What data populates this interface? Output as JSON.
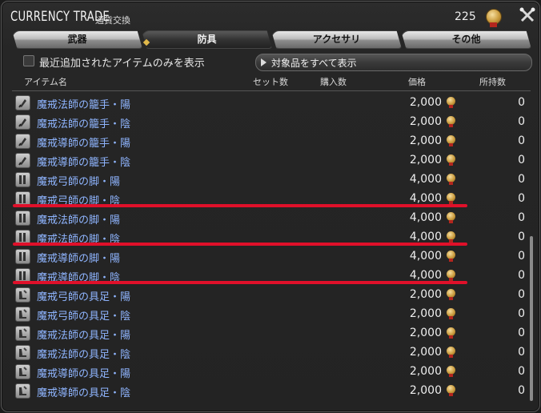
{
  "window": {
    "title": "CURRENCY TRADE",
    "subtitle": "通貨交換",
    "currency_count": "225"
  },
  "tabs": [
    {
      "label": "武器",
      "active": false
    },
    {
      "label": "防具",
      "active": true
    },
    {
      "label": "アクセサリ",
      "active": false
    },
    {
      "label": "その他",
      "active": false
    }
  ],
  "filter": {
    "checkbox_label": "最近追加されたアイテムのみを表示",
    "checked": false,
    "show_all_label": "対象品をすべて表示"
  },
  "columns": {
    "item_name": "アイテム名",
    "set_count": "セット数",
    "purchase_count": "購入数",
    "price": "価格",
    "owned": "所持数"
  },
  "rows": [
    {
      "icon": "gauntlet-icon",
      "name": "魔戒法師の籠手・陽",
      "price": "2,000",
      "owned": "0"
    },
    {
      "icon": "gauntlet-icon",
      "name": "魔戒法師の籠手・陰",
      "price": "2,000",
      "owned": "0"
    },
    {
      "icon": "gauntlet-icon",
      "name": "魔戒導師の籠手・陽",
      "price": "2,000",
      "owned": "0"
    },
    {
      "icon": "gauntlet-icon",
      "name": "魔戒導師の籠手・陰",
      "price": "2,000",
      "owned": "0"
    },
    {
      "icon": "legs-icon",
      "name": "魔戒弓師の脚・陽",
      "price": "4,000",
      "owned": "0"
    },
    {
      "icon": "legs-icon",
      "name": "魔戒弓師の脚・陰",
      "price": "4,000",
      "owned": "0"
    },
    {
      "icon": "legs-icon",
      "name": "魔戒法師の脚・陽",
      "price": "4,000",
      "owned": "0"
    },
    {
      "icon": "legs-icon",
      "name": "魔戒法師の脚・陰",
      "price": "4,000",
      "owned": "0"
    },
    {
      "icon": "legs-icon",
      "name": "魔戒導師の脚・陽",
      "price": "4,000",
      "owned": "0"
    },
    {
      "icon": "legs-icon",
      "name": "魔戒導師の脚・陰",
      "price": "4,000",
      "owned": "0"
    },
    {
      "icon": "boots-icon",
      "name": "魔戒弓師の具足・陽",
      "price": "2,000",
      "owned": "0"
    },
    {
      "icon": "boots-icon",
      "name": "魔戒弓師の具足・陰",
      "price": "2,000",
      "owned": "0"
    },
    {
      "icon": "boots-icon",
      "name": "魔戒法師の具足・陽",
      "price": "2,000",
      "owned": "0"
    },
    {
      "icon": "boots-icon",
      "name": "魔戒法師の具足・陰",
      "price": "2,000",
      "owned": "0"
    },
    {
      "icon": "boots-icon",
      "name": "魔戒導師の具足・陽",
      "price": "2,000",
      "owned": "0"
    },
    {
      "icon": "boots-icon",
      "name": "魔戒導師の具足・陰",
      "price": "2,000",
      "owned": "0"
    }
  ],
  "annotations": {
    "highlight_color": "#e0102a"
  },
  "colors": {
    "item_link": "#8fb5ff",
    "accent_gold": "#c99a3c"
  }
}
